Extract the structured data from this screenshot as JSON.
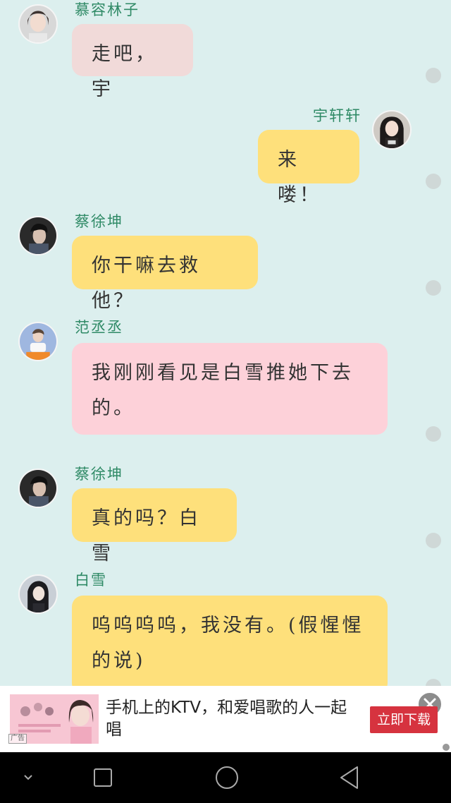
{
  "messages": [
    {
      "sender": "慕容林子",
      "text": "走吧，宇",
      "side": "left",
      "bubble_color": "#f1dad9"
    },
    {
      "sender": "宇轩轩",
      "text": "来喽！",
      "side": "right",
      "bubble_color": "#fee07b"
    },
    {
      "sender": "蔡徐坤",
      "text": "你干嘛去救他？",
      "side": "left",
      "bubble_color": "#fee07b"
    },
    {
      "sender": "范丞丞",
      "text": "我刚刚看见是白雪推她下去的。",
      "side": "left",
      "bubble_color": "#fdd1d9"
    },
    {
      "sender": "蔡徐坤",
      "text": "真的吗？白雪",
      "side": "left",
      "bubble_color": "#fee07b"
    },
    {
      "sender": "白雪",
      "text": "呜呜呜呜，我没有。(假惺惺的说)",
      "side": "left",
      "bubble_color": "#fee07b"
    }
  ],
  "ad": {
    "text": "手机上的KTV，和爱唱歌的人一起唱",
    "button_label": "立即下载",
    "tag": "广告",
    "close_icon": "close-icon"
  },
  "navbar": {
    "icons": [
      "chevron-down-icon",
      "recent-apps-icon",
      "home-icon",
      "back-icon"
    ]
  },
  "colors": {
    "background": "#dcefee",
    "name_text": "#2f8a66",
    "ad_button": "#d6333f"
  }
}
